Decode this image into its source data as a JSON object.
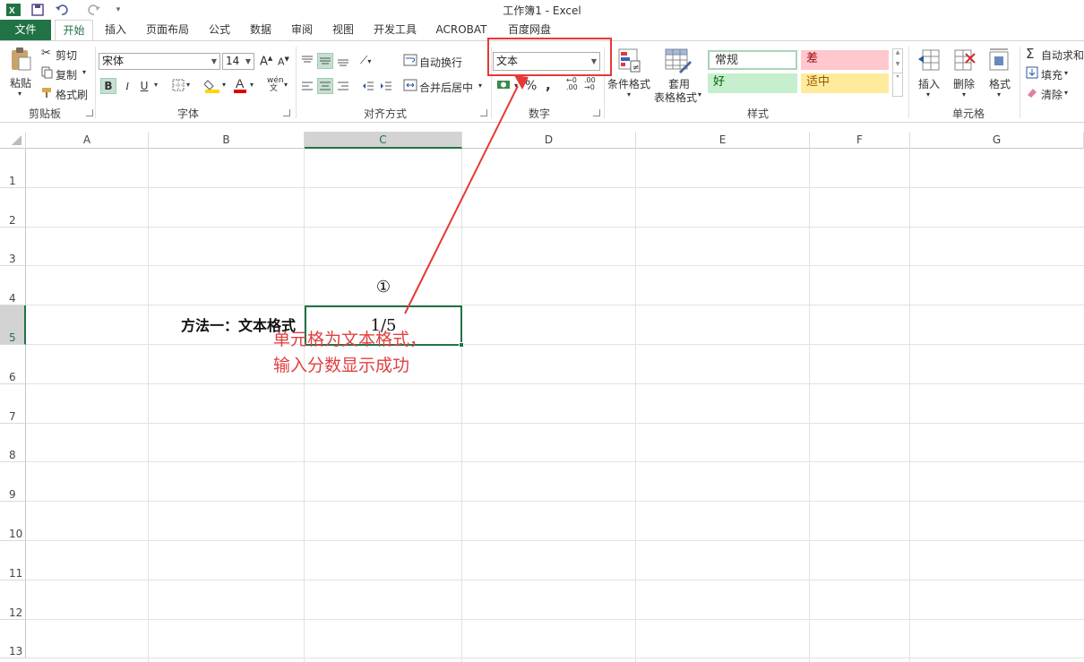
{
  "window": {
    "title": "工作簿1 - Excel"
  },
  "tabs": [
    {
      "label": "文件"
    },
    {
      "label": "开始"
    },
    {
      "label": "插入"
    },
    {
      "label": "页面布局"
    },
    {
      "label": "公式"
    },
    {
      "label": "数据"
    },
    {
      "label": "审阅"
    },
    {
      "label": "视图"
    },
    {
      "label": "开发工具"
    },
    {
      "label": "ACROBAT"
    },
    {
      "label": "百度网盘"
    }
  ],
  "clipboard": {
    "paste": "粘贴",
    "cut": "剪切",
    "copy": "复制",
    "format_painter": "格式刷",
    "group": "剪贴板"
  },
  "font": {
    "name": "宋体",
    "size": "14",
    "group": "字体",
    "bold": "B",
    "italic": "I",
    "underline": "U",
    "grow": "A",
    "shrink": "A"
  },
  "alignment": {
    "wrap": "自动换行",
    "merge": "合并后居中",
    "group": "对齐方式"
  },
  "number": {
    "format": "文本",
    "percent": "%",
    "comma": ",",
    "group": "数字"
  },
  "styles": {
    "conditional": "条件格式",
    "table_line1": "套用",
    "table_line2": "表格格式",
    "normal": "常规",
    "bad": "差",
    "good": "好",
    "neutral": "适中",
    "group": "样式",
    "colors": {
      "bad_bg": "#ffc7ce",
      "bad_fg": "#9c0006",
      "good_bg": "#c6efce",
      "good_fg": "#006100",
      "neutral_bg": "#ffeb9c",
      "neutral_fg": "#9c5700"
    }
  },
  "cells_group": {
    "insert": "插入",
    "delete": "删除",
    "format": "格式",
    "group": "单元格"
  },
  "editing": {
    "autosum": "自动求和",
    "fill": "填充",
    "clear": "清除"
  },
  "sheet": {
    "columns": [
      "A",
      "B",
      "C",
      "D",
      "E",
      "F",
      "G"
    ],
    "rows": [
      "1",
      "2",
      "3",
      "4",
      "5",
      "6",
      "7",
      "8",
      "9",
      "10",
      "11",
      "12",
      "13"
    ],
    "b5": "方法一：文本格式",
    "c5": "1/5",
    "c4_marker": "①"
  },
  "annotation": {
    "line1": "单元格为文本格式，",
    "line2": "输入分数显示成功",
    "color": "#e53935"
  }
}
